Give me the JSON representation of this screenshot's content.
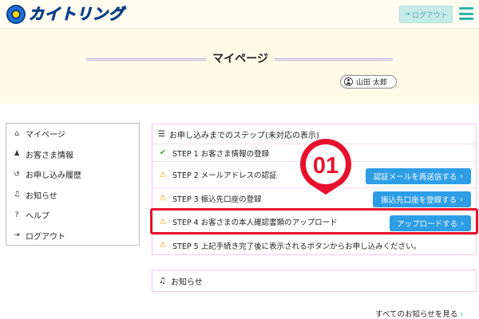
{
  "header": {
    "logo_text": "カイトリング",
    "logout_label": "ログアウト",
    "menu_icon": "hamburger-icon"
  },
  "title_band": {
    "page_title": "マイページ",
    "user_name": "山田 太郎"
  },
  "sidebar": {
    "items": [
      {
        "label": "マイページ",
        "icon": "home-icon"
      },
      {
        "label": "お客さま情報",
        "icon": "user-icon"
      },
      {
        "label": "お申し込み履歴",
        "icon": "history-icon"
      },
      {
        "label": "お知らせ",
        "icon": "bell-icon"
      },
      {
        "label": "ヘルプ",
        "icon": "help-icon"
      },
      {
        "label": "ログアウト",
        "icon": "logout-icon"
      }
    ]
  },
  "steps_panel": {
    "heading": "お申し込みまでのステップ(未対応の表示)",
    "steps": [
      {
        "label": "STEP 1  お客さま情報の登録",
        "status": "done"
      },
      {
        "label": "STEP 2  メールアドレスの認証",
        "status": "pending",
        "button": "認証メールを再送信する"
      },
      {
        "label": "STEP 3  振込先口座の登録",
        "status": "pending",
        "button": "振込先口座を登録する"
      },
      {
        "label": "STEP 4  お客さまの本人確認書類のアップロード",
        "status": "pending",
        "button": "アップロードする"
      },
      {
        "label": "STEP 5  上記手続き完了後に表示されるボタンからお申し込みください。",
        "status": "pending"
      }
    ]
  },
  "marker": {
    "number": "01"
  },
  "notices": {
    "heading": "お知らせ",
    "see_all": "すべてのお知らせを見る"
  },
  "colors": {
    "accent_teal": "#2cb4ad",
    "button_blue": "#2d9de6",
    "highlight_red": "#e8112d",
    "warning_yellow": "#e8a500"
  }
}
